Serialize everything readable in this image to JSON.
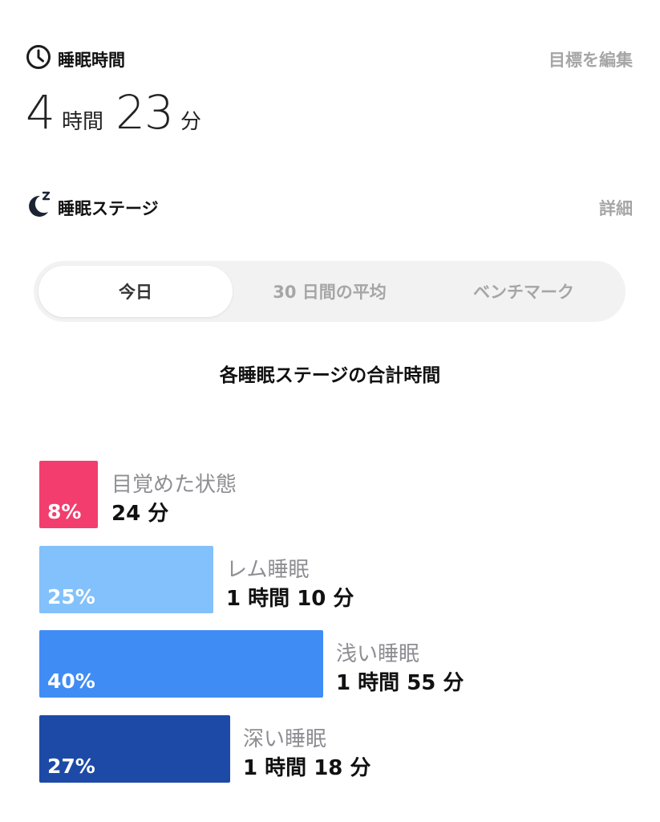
{
  "sleep_time": {
    "title": "睡眠時間",
    "edit_goal": "目標を編集",
    "hours": "4",
    "hours_unit": "時間",
    "minutes": "23",
    "minutes_unit": "分",
    "icon": "clock-icon"
  },
  "stages": {
    "title": "睡眠ステージ",
    "details": "詳細",
    "icon": "moon-zzz-icon",
    "tabs": [
      {
        "label": "今日",
        "selected": true
      },
      {
        "label": "30 日間の平均",
        "selected": false
      },
      {
        "label": "ベンチマーク",
        "selected": false
      }
    ],
    "chart_title": "各睡眠ステージの合計時間",
    "items": [
      {
        "name": "目覚めた状態",
        "percent": "8%",
        "duration": "24 分",
        "color": "#f23d6e"
      },
      {
        "name": "レム睡眠",
        "percent": "25%",
        "duration": "1 時間 10 分",
        "color": "#82c1fb"
      },
      {
        "name": "浅い睡眠",
        "percent": "40%",
        "duration": "1 時間 55 分",
        "color": "#3f8cf5"
      },
      {
        "name": "深い睡眠",
        "percent": "27%",
        "duration": "1 時間 18 分",
        "color": "#1c4aa6"
      }
    ]
  }
}
